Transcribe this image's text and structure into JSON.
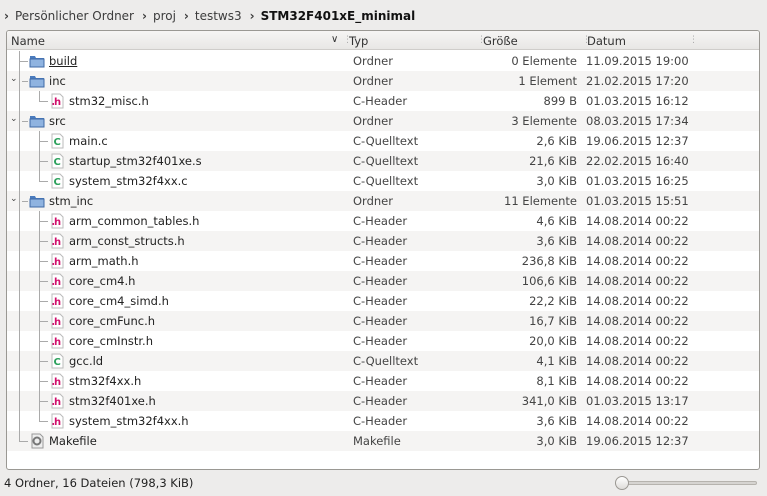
{
  "breadcrumb": [
    "Persönlicher Ordner",
    "proj",
    "testws3",
    "STM32F401xE_minimal"
  ],
  "columns": {
    "name": "Name",
    "type": "Typ",
    "size": "Größe",
    "date": "Datum"
  },
  "rows": [
    {
      "name": "build",
      "type": "Ordner",
      "size": "0 Elemente",
      "date": "11.09.2015 19:00",
      "level": 0,
      "kind": "folder",
      "expanded": false,
      "underline": true
    },
    {
      "name": "inc",
      "type": "Ordner",
      "size": "1 Element",
      "date": "21.02.2015 17:20",
      "level": 0,
      "kind": "folder",
      "expanded": true
    },
    {
      "name": "stm32_misc.h",
      "type": "C-Header",
      "size": "899 B",
      "date": "01.03.2015 16:12",
      "level": 1,
      "kind": "h",
      "last": true
    },
    {
      "name": "src",
      "type": "Ordner",
      "size": "3 Elemente",
      "date": "08.03.2015 17:34",
      "level": 0,
      "kind": "folder",
      "expanded": true
    },
    {
      "name": "main.c",
      "type": "C-Quelltext",
      "size": "2,6 KiB",
      "date": "19.06.2015 12:37",
      "level": 1,
      "kind": "c"
    },
    {
      "name": "startup_stm32f401xe.s",
      "type": "C-Quelltext",
      "size": "21,6 KiB",
      "date": "22.02.2015 16:40",
      "level": 1,
      "kind": "c"
    },
    {
      "name": "system_stm32f4xx.c",
      "type": "C-Quelltext",
      "size": "3,0 KiB",
      "date": "01.03.2015 16:25",
      "level": 1,
      "kind": "c",
      "last": true
    },
    {
      "name": "stm_inc",
      "type": "Ordner",
      "size": "11 Elemente",
      "date": "01.03.2015 15:51",
      "level": 0,
      "kind": "folder",
      "expanded": true
    },
    {
      "name": "arm_common_tables.h",
      "type": "C-Header",
      "size": "4,6 KiB",
      "date": "14.08.2014 00:22",
      "level": 1,
      "kind": "h"
    },
    {
      "name": "arm_const_structs.h",
      "type": "C-Header",
      "size": "3,6 KiB",
      "date": "14.08.2014 00:22",
      "level": 1,
      "kind": "h"
    },
    {
      "name": "arm_math.h",
      "type": "C-Header",
      "size": "236,8 KiB",
      "date": "14.08.2014 00:22",
      "level": 1,
      "kind": "h"
    },
    {
      "name": "core_cm4.h",
      "type": "C-Header",
      "size": "106,6 KiB",
      "date": "14.08.2014 00:22",
      "level": 1,
      "kind": "h"
    },
    {
      "name": "core_cm4_simd.h",
      "type": "C-Header",
      "size": "22,2 KiB",
      "date": "14.08.2014 00:22",
      "level": 1,
      "kind": "h"
    },
    {
      "name": "core_cmFunc.h",
      "type": "C-Header",
      "size": "16,7 KiB",
      "date": "14.08.2014 00:22",
      "level": 1,
      "kind": "h"
    },
    {
      "name": "core_cmInstr.h",
      "type": "C-Header",
      "size": "20,0 KiB",
      "date": "14.08.2014 00:22",
      "level": 1,
      "kind": "h"
    },
    {
      "name": "gcc.ld",
      "type": "C-Quelltext",
      "size": "4,1 KiB",
      "date": "14.08.2014 00:22",
      "level": 1,
      "kind": "c"
    },
    {
      "name": "stm32f4xx.h",
      "type": "C-Header",
      "size": "8,1 KiB",
      "date": "14.08.2014 00:22",
      "level": 1,
      "kind": "h"
    },
    {
      "name": "stm32f401xe.h",
      "type": "C-Header",
      "size": "341,0 KiB",
      "date": "01.03.2015 13:17",
      "level": 1,
      "kind": "h"
    },
    {
      "name": "system_stm32f4xx.h",
      "type": "C-Header",
      "size": "3,6 KiB",
      "date": "14.08.2014 00:22",
      "level": 1,
      "kind": "h",
      "last": true
    },
    {
      "name": "Makefile",
      "type": "Makefile",
      "size": "3,0 KiB",
      "date": "19.06.2015 12:37",
      "level": 0,
      "kind": "make",
      "lastTop": true
    }
  ],
  "status": "4 Ordner, 16 Dateien (798,3 KiB)",
  "zoom_level": 0
}
